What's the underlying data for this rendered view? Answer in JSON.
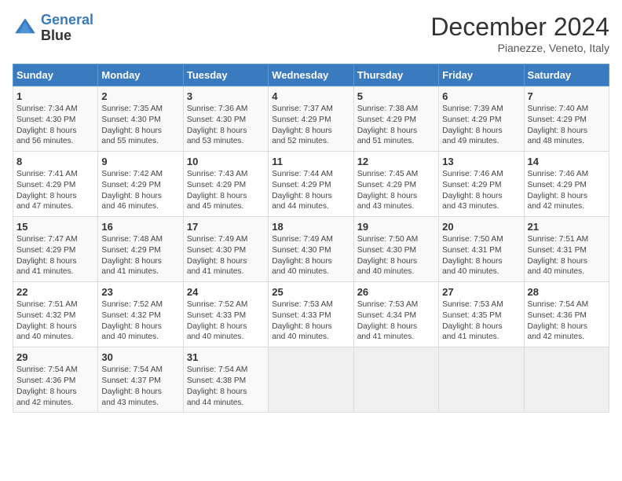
{
  "header": {
    "logo_line1": "General",
    "logo_line2": "Blue",
    "month": "December 2024",
    "location": "Pianezze, Veneto, Italy"
  },
  "days_of_week": [
    "Sunday",
    "Monday",
    "Tuesday",
    "Wednesday",
    "Thursday",
    "Friday",
    "Saturday"
  ],
  "weeks": [
    [
      {
        "day": "1",
        "rise": "7:34 AM",
        "set": "4:30 PM",
        "daylight": "8 hours and 56 minutes."
      },
      {
        "day": "2",
        "rise": "7:35 AM",
        "set": "4:30 PM",
        "daylight": "8 hours and 55 minutes."
      },
      {
        "day": "3",
        "rise": "7:36 AM",
        "set": "4:30 PM",
        "daylight": "8 hours and 53 minutes."
      },
      {
        "day": "4",
        "rise": "7:37 AM",
        "set": "4:29 PM",
        "daylight": "8 hours and 52 minutes."
      },
      {
        "day": "5",
        "rise": "7:38 AM",
        "set": "4:29 PM",
        "daylight": "8 hours and 51 minutes."
      },
      {
        "day": "6",
        "rise": "7:39 AM",
        "set": "4:29 PM",
        "daylight": "8 hours and 49 minutes."
      },
      {
        "day": "7",
        "rise": "7:40 AM",
        "set": "4:29 PM",
        "daylight": "8 hours and 48 minutes."
      }
    ],
    [
      {
        "day": "8",
        "rise": "7:41 AM",
        "set": "4:29 PM",
        "daylight": "8 hours and 47 minutes."
      },
      {
        "day": "9",
        "rise": "7:42 AM",
        "set": "4:29 PM",
        "daylight": "8 hours and 46 minutes."
      },
      {
        "day": "10",
        "rise": "7:43 AM",
        "set": "4:29 PM",
        "daylight": "8 hours and 45 minutes."
      },
      {
        "day": "11",
        "rise": "7:44 AM",
        "set": "4:29 PM",
        "daylight": "8 hours and 44 minutes."
      },
      {
        "day": "12",
        "rise": "7:45 AM",
        "set": "4:29 PM",
        "daylight": "8 hours and 43 minutes."
      },
      {
        "day": "13",
        "rise": "7:46 AM",
        "set": "4:29 PM",
        "daylight": "8 hours and 43 minutes."
      },
      {
        "day": "14",
        "rise": "7:46 AM",
        "set": "4:29 PM",
        "daylight": "8 hours and 42 minutes."
      }
    ],
    [
      {
        "day": "15",
        "rise": "7:47 AM",
        "set": "4:29 PM",
        "daylight": "8 hours and 41 minutes."
      },
      {
        "day": "16",
        "rise": "7:48 AM",
        "set": "4:29 PM",
        "daylight": "8 hours and 41 minutes."
      },
      {
        "day": "17",
        "rise": "7:49 AM",
        "set": "4:30 PM",
        "daylight": "8 hours and 41 minutes."
      },
      {
        "day": "18",
        "rise": "7:49 AM",
        "set": "4:30 PM",
        "daylight": "8 hours and 40 minutes."
      },
      {
        "day": "19",
        "rise": "7:50 AM",
        "set": "4:30 PM",
        "daylight": "8 hours and 40 minutes."
      },
      {
        "day": "20",
        "rise": "7:50 AM",
        "set": "4:31 PM",
        "daylight": "8 hours and 40 minutes."
      },
      {
        "day": "21",
        "rise": "7:51 AM",
        "set": "4:31 PM",
        "daylight": "8 hours and 40 minutes."
      }
    ],
    [
      {
        "day": "22",
        "rise": "7:51 AM",
        "set": "4:32 PM",
        "daylight": "8 hours and 40 minutes."
      },
      {
        "day": "23",
        "rise": "7:52 AM",
        "set": "4:32 PM",
        "daylight": "8 hours and 40 minutes."
      },
      {
        "day": "24",
        "rise": "7:52 AM",
        "set": "4:33 PM",
        "daylight": "8 hours and 40 minutes."
      },
      {
        "day": "25",
        "rise": "7:53 AM",
        "set": "4:33 PM",
        "daylight": "8 hours and 40 minutes."
      },
      {
        "day": "26",
        "rise": "7:53 AM",
        "set": "4:34 PM",
        "daylight": "8 hours and 41 minutes."
      },
      {
        "day": "27",
        "rise": "7:53 AM",
        "set": "4:35 PM",
        "daylight": "8 hours and 41 minutes."
      },
      {
        "day": "28",
        "rise": "7:54 AM",
        "set": "4:36 PM",
        "daylight": "8 hours and 42 minutes."
      }
    ],
    [
      {
        "day": "29",
        "rise": "7:54 AM",
        "set": "4:36 PM",
        "daylight": "8 hours and 42 minutes."
      },
      {
        "day": "30",
        "rise": "7:54 AM",
        "set": "4:37 PM",
        "daylight": "8 hours and 43 minutes."
      },
      {
        "day": "31",
        "rise": "7:54 AM",
        "set": "4:38 PM",
        "daylight": "8 hours and 44 minutes."
      },
      null,
      null,
      null,
      null
    ]
  ],
  "labels": {
    "sunrise": "Sunrise: ",
    "sunset": "Sunset: ",
    "daylight": "Daylight: "
  }
}
